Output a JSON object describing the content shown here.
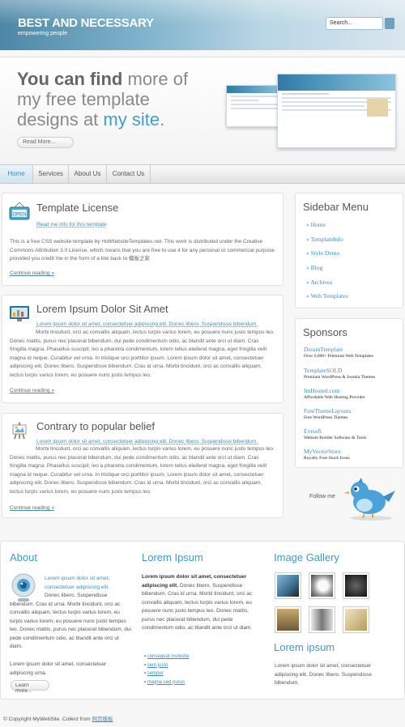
{
  "header": {
    "logo": "BEST AND NECESSARY",
    "tagline": "empowering people",
    "search_placeholder": "Search..."
  },
  "banner": {
    "headline_1_bold": "You can find",
    "headline_1_rest": " more of",
    "headline_2": "my free template",
    "headline_3": "designs at ",
    "headline_link": "my site",
    "headline_end": ".",
    "button": "Read More..."
  },
  "nav": {
    "items": [
      "Home",
      "Services",
      "About Us",
      "Contact Us"
    ]
  },
  "posts": [
    {
      "title": "Template License",
      "subtitle": "Read me info for this template",
      "body": "This is a free CSS website template by HotWebsiteTemplates.net. This work is distributed under the Creative Commons Attribution 3.0 License, which means that you are free to use it for any personal or commercial purpose provided you credit me in the form of a link back to 模板之家",
      "continue": "Continue reading",
      "arrow": "»"
    },
    {
      "title": "Lorem Ipsum Dolor Sit Amet",
      "subtitle": "Lorem ipsum dolor sit amet, consectetuer adipiscing elit. Donec libero. Suspendisse bibendum.",
      "body": "Morbi tincidunt, orci ac convallis aliquam, lectus turpis varius lorem, eu posuere nunc justo tempus leo. Donec mattis, purus nec placerat bibendum, dui pede condimentum odio, ac blandit ante orci ut diam. Cras fringilla magna. Phasellus suscipit, leo a pharetra condimentum, lorem tellus eleifend magna, eget fringilla velit magna id neque. Curabitur vel urna. In tristique orci porttitor ipsum. Lorem ipsum dolor sit amet, consectetuer adipiscing elit. Donec libero. Suspendisse bibendum. Cras id urna. Morbi tincidunt, orci ac convallis aliquam, lectus turpis varius lorem, eu posuere nunc justo tempus leo.",
      "continue": "Continue reading",
      "arrow": "»"
    },
    {
      "title": "Contrary to popular belief",
      "subtitle": "Lorem ipsum dolor sit amet, consectetuer adipiscing elit. Donec libero. Suspendisse bibendum.",
      "body": "Morbi tincidunt, orci ac convallis aliquam, lectus turpis varius lorem, eu posuere nunc justo tempus leo. Donec mattis, purus nec placerat bibendum, dui pede condimentum odio, ac blandit ante orci ut diam. Cras fringilla magna. Phasellus suscipit, leo a pharetra condimentum, lorem tellus eleifend magna, eget fringilla velit magna id neque. Curabitur vel urna. In tristique orci porttitor ipsum. Lorem ipsum dolor sit amet, consectetuer adipiscing elit. Donec libero. Suspendisse bibendum. Cras id urna. Morbi tincidunt, orci ac convallis aliquam, lectus turpis varius lorem, eu posuere nunc justo tempus leo.",
      "continue": "Continue reading",
      "arrow": "»"
    }
  ],
  "sidebar": {
    "title": "Sidebar Menu",
    "items": [
      "» Home",
      "» TemplateInfo",
      "» Style Demo",
      "» Blog",
      "» Archives",
      "» Web Templates"
    ]
  },
  "sponsors": {
    "title": "Sponsors",
    "items": [
      {
        "name": "DreamTemplate",
        "desc": "Over 6,000+ Premium Web Templates"
      },
      {
        "name": "TemplateSOLD",
        "desc": "Premium WordPress & Joomla Themes"
      },
      {
        "name": "ImHosted.com",
        "desc": "Affordable Web Hosting Provider"
      },
      {
        "name": "FreeThemeLayouts",
        "desc": "Free WordPress Themes"
      },
      {
        "name": "Evrsoft",
        "desc": "Website Builder Software & Tools"
      },
      {
        "name": "MyVectorStore",
        "desc": "Royalty Free Stock Icons"
      }
    ]
  },
  "follow": "Follow me",
  "footer": {
    "about": {
      "title": "About",
      "intro_link": "Lorem ipsum dolor sit amet, consectetuer adipiscing elit.",
      "intro": "Donec libero. Suspendisse bibendum. Cras id urna. Morbi tincidunt, orci ac convallis aliquam, lectus turpis varius lorem, eu turpis varius lorem, eu posuere nunc justo tempus leo. Donec mattis, purus nec placerat bibendum, dui pede condimentum odio, ac blandit ante orci ut diam.",
      "text2": "Lorem ipsum dolor sit amet, consectetuer adipiscing urna.",
      "button": "Learn more..."
    },
    "lorem": {
      "title": "Lorem Ipsum",
      "bold": "Lorem ipsum dolor sit amet, consectetuer adipiscing elit.",
      "text": "Donec libero. Suspendisse bibendum. Cras id urna. Morbi tincidunt, orci ac convallis aliquam, lectus turpis varius lorem, eu posuere nunc justo tempus leo. Donec mattis, purus nec placerat bibendum, dui pede condimentum odio, ac blandit ante orci ut diam.",
      "links": [
        "consequat molestie",
        "sem justo",
        "semper",
        "magna sed purus"
      ]
    },
    "gallery": {
      "title": "Image Gallery",
      "title2": "Lorem ipsum",
      "text2": "Lorem ipsum dolor sit amet, consectetuer adipiscing elit. Donec libero. Suspendisse bibendum."
    }
  },
  "copyright": "© Copyright MyWebSite. Collect from ",
  "copyright_link": "网页模板"
}
